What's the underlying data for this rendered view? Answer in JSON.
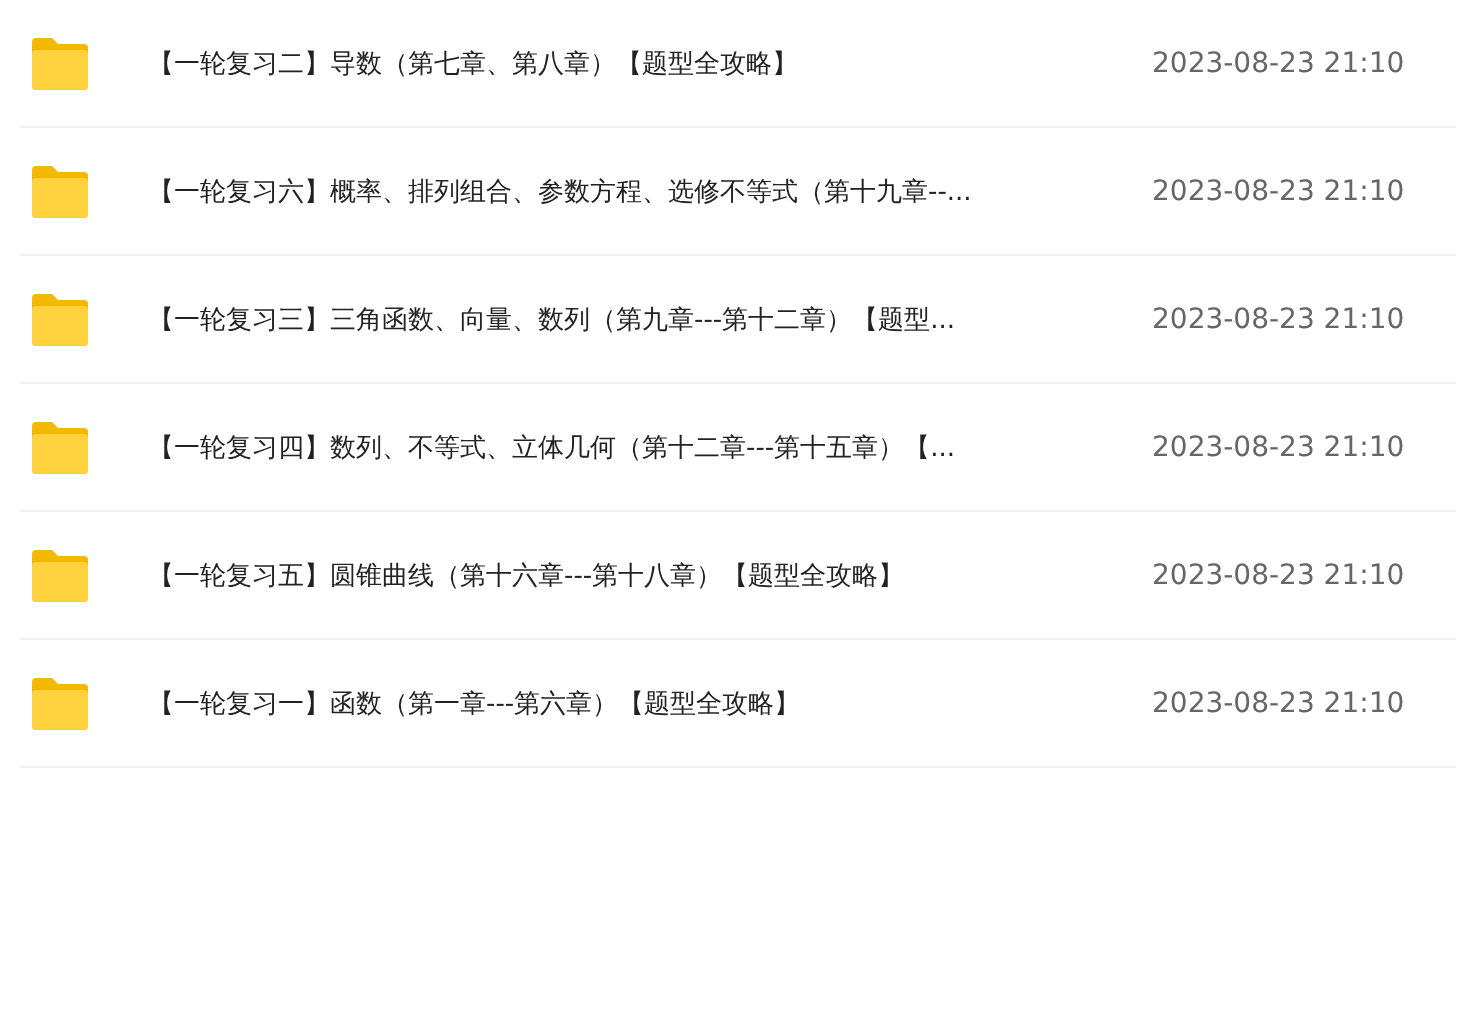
{
  "files": [
    {
      "kind": "folder",
      "name": "【一轮复习二】导数（第七章、第八章）【题型全攻略】",
      "date": "2023-08-23 21:10"
    },
    {
      "kind": "folder",
      "name": "【一轮复习六】概率、排列组合、参数方程、选修不等式（第十九章--...",
      "date": "2023-08-23 21:10"
    },
    {
      "kind": "folder",
      "name": "【一轮复习三】三角函数、向量、数列（第九章---第十二章）【题型...",
      "date": "2023-08-23 21:10"
    },
    {
      "kind": "folder",
      "name": "【一轮复习四】数列、不等式、立体几何（第十二章---第十五章）【...",
      "date": "2023-08-23 21:10"
    },
    {
      "kind": "folder",
      "name": "【一轮复习五】圆锥曲线（第十六章---第十八章）【题型全攻略】",
      "date": "2023-08-23 21:10"
    },
    {
      "kind": "folder",
      "name": "【一轮复习一】函数（第一章---第六章）【题型全攻略】",
      "date": "2023-08-23 21:10"
    }
  ]
}
